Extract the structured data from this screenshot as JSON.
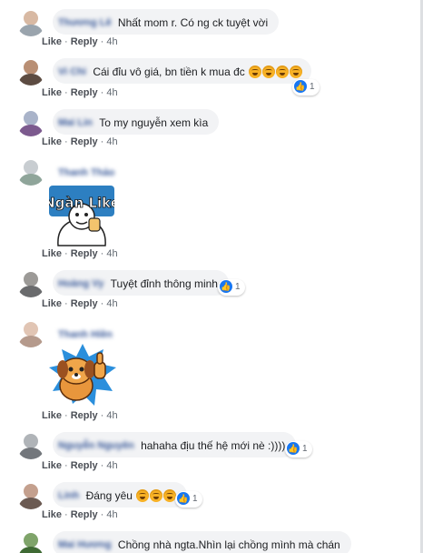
{
  "actions": {
    "like": "Like",
    "reply": "Reply",
    "separator": "·",
    "time": "4h"
  },
  "comments": [
    {
      "name": "Thương Lê",
      "text": "Nhất mom r. Có ng ck tuyệt vời",
      "avatar_face": "#d8b9a3",
      "avatar_body": "#9aa4ad"
    },
    {
      "name": "Vi Chi",
      "text": "Cái đỉu vô giá, bn tiền k mua đc",
      "emoji_count": 4,
      "reactions": "1",
      "avatar_face": "#b98f74",
      "avatar_body": "#5d4c42"
    },
    {
      "name": "Mai Lin",
      "text": "To my nguyễn xem kìa",
      "avatar_face": "#a9b3c9",
      "avatar_body": "#7c5a8e"
    },
    {
      "name": "Thanh Thảo",
      "text": "",
      "sticker": "Ngàn Like",
      "avatar_face": "#c8cdd1",
      "avatar_body": "#8fa59a"
    },
    {
      "name": "Hoàng Vy",
      "text": "Tuyệt đỉnh thông minh",
      "reactions": "1",
      "avatar_face": "#9c9a97",
      "avatar_body": "#6a6b6d"
    },
    {
      "name": "Thanh Hiền",
      "text": "",
      "sticker": "thumbs-up-dog",
      "avatar_face": "#e1c5b4",
      "avatar_body": "#b59a8c"
    },
    {
      "name": "Nguyễn Nguyên",
      "text": "hahaha địu thế hệ mới nè :))))",
      "reactions": "1",
      "avatar_face": "#b0b4b8",
      "avatar_body": "#73777c"
    },
    {
      "name": "Linh",
      "text": "Đáng yêu",
      "emoji_count": 3,
      "reactions": "1",
      "avatar_face": "#c4a08e",
      "avatar_body": "#6b5a52"
    },
    {
      "name": "Mai Hương",
      "text": "Chồng nhà ngta.Nhìn lại chồng mình mà chán",
      "avatar_face": "#7fa46a",
      "avatar_body": "#3f6a34"
    }
  ]
}
